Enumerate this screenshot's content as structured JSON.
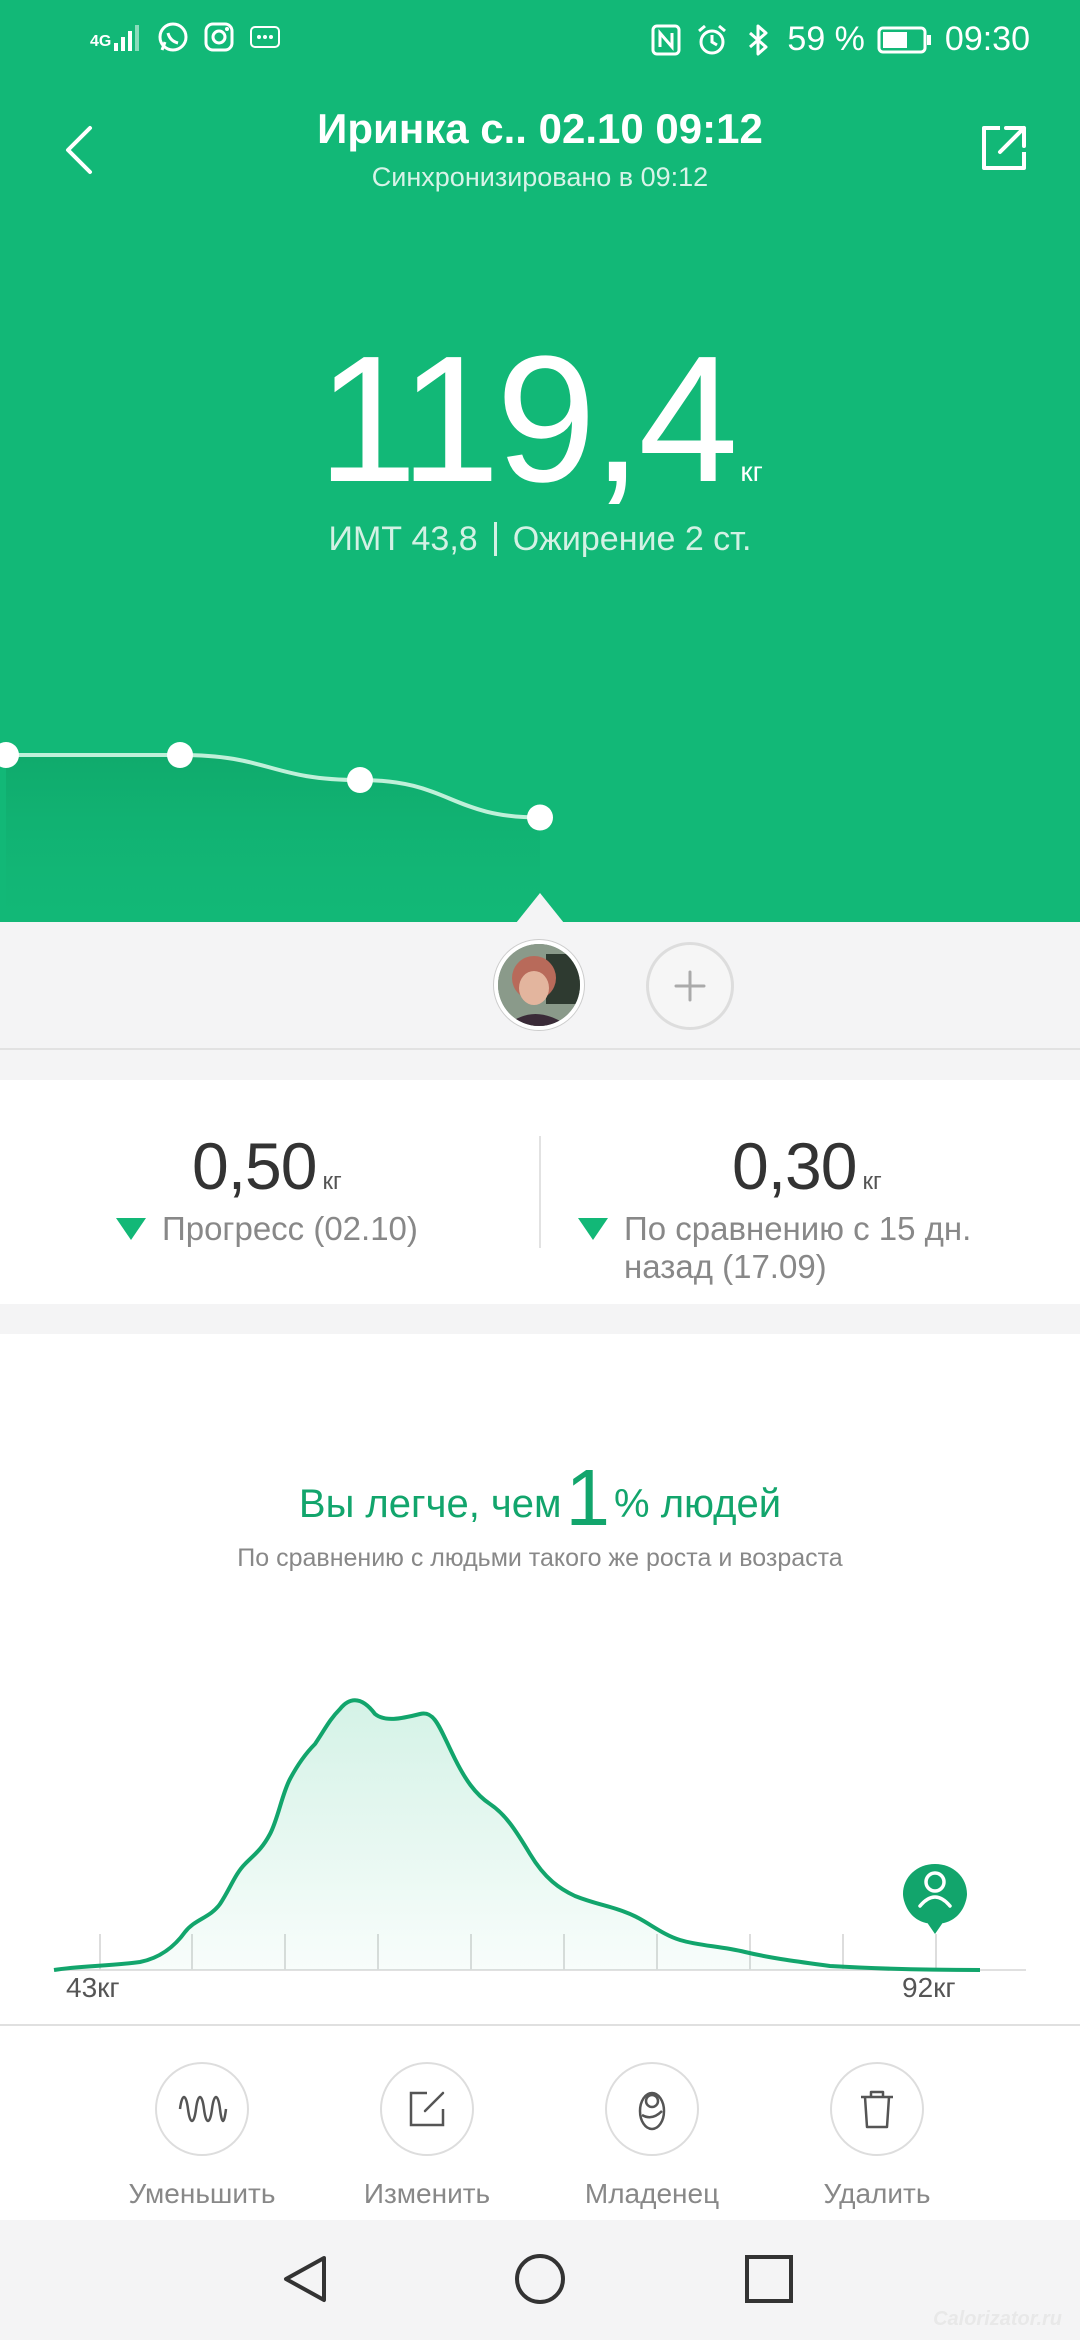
{
  "status_bar": {
    "network": "4G",
    "battery": "59 %",
    "time": "09:30",
    "app_icons": [
      "whatsapp-icon",
      "instagram-icon",
      "bubble-icon"
    ],
    "system_icons": [
      "nfc-icon",
      "alarm-icon",
      "bluetooth-icon",
      "battery-icon"
    ]
  },
  "header": {
    "title": "Иринка с.. 02.10 09:12",
    "subtitle": "Синхронизировано в 09:12"
  },
  "measurement": {
    "weight": "119,4",
    "unit": "кг",
    "bmi_label": "ИМТ 43,8",
    "status_label": "Ожирение 2 ст."
  },
  "trend_points": [
    119.9,
    119.9,
    119.7,
    119.4
  ],
  "progress": {
    "left": {
      "value": "0,50",
      "unit": "кг",
      "label": "Прогресс (02.10)"
    },
    "right": {
      "value": "0,30",
      "unit": "кг",
      "label": "По сравнению с 15 дн. назад (17.09)"
    }
  },
  "comparison": {
    "title_before": "Вы легче, чем",
    "title_number": "1",
    "title_after": "% людей",
    "subtitle": "По сравнению с людьми такого же роста и возраста",
    "axis_min": "43кг",
    "axis_max": "92кг"
  },
  "actions": [
    {
      "label": "Уменьшить",
      "icon": "wave-icon"
    },
    {
      "label": "Изменить",
      "icon": "edit-icon"
    },
    {
      "label": "Младенец",
      "icon": "baby-icon"
    },
    {
      "label": "Удалить",
      "icon": "trash-icon"
    }
  ],
  "watermark": "Calorizator.ru",
  "colors": {
    "accent": "#12b877",
    "accent_dark": "#12a56c"
  }
}
